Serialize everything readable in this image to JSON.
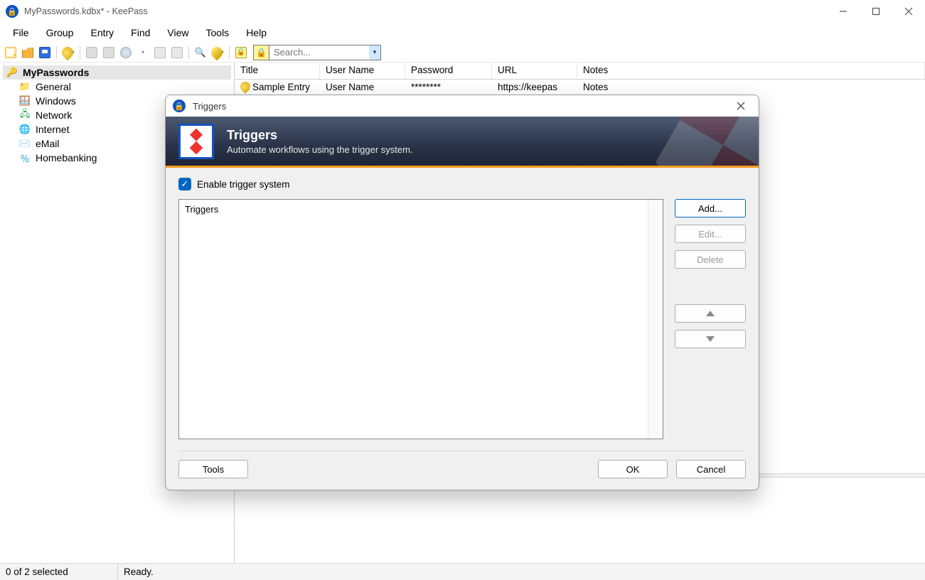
{
  "window": {
    "title": "MyPasswords.kdbx* - KeePass"
  },
  "menu": {
    "items": [
      "File",
      "Group",
      "Entry",
      "Find",
      "View",
      "Tools",
      "Help"
    ]
  },
  "search": {
    "placeholder": "Search..."
  },
  "tree": {
    "root": "MyPasswords",
    "children": [
      "General",
      "Windows",
      "Network",
      "Internet",
      "eMail",
      "Homebanking"
    ]
  },
  "list": {
    "columns": [
      "Title",
      "User Name",
      "Password",
      "URL",
      "Notes"
    ],
    "rows": [
      {
        "title": "Sample Entry",
        "user": "User Name",
        "pass": "********",
        "url": "https://keepas",
        "notes": "Notes"
      }
    ]
  },
  "status": {
    "selection": "0 of 2 selected",
    "state": "Ready."
  },
  "dialog": {
    "title": "Triggers",
    "heading": "Triggers",
    "subheading": "Automate workflows using the trigger system.",
    "enable_label": "Enable trigger system",
    "list_header": "Triggers",
    "buttons": {
      "add": "Add...",
      "edit": "Edit...",
      "delete": "Delete",
      "tools": "Tools",
      "ok": "OK",
      "cancel": "Cancel"
    }
  }
}
